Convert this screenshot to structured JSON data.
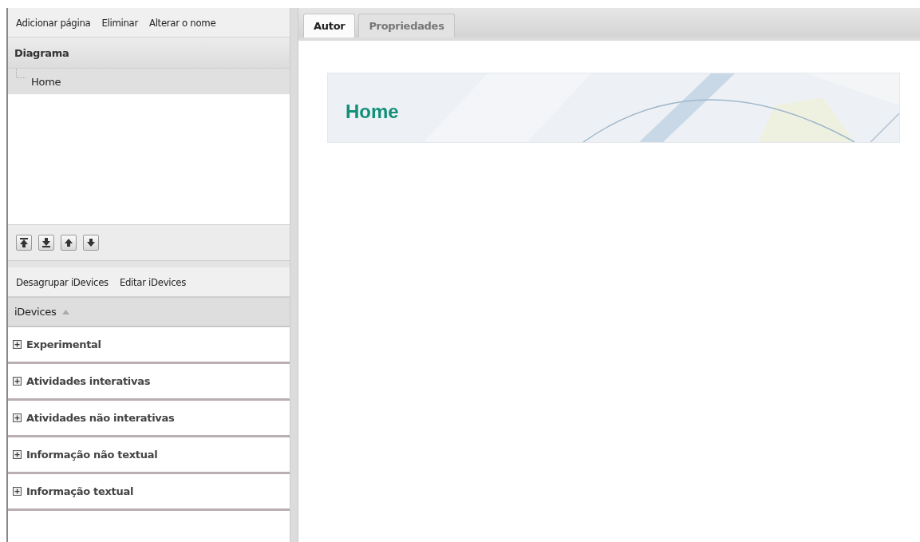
{
  "outline_panel": {
    "toolbar": [
      "Adicionar página",
      "Eliminar",
      "Alterar o nome"
    ],
    "header": "Diagrama",
    "tree": [
      {
        "label": "Home",
        "selected": true
      }
    ],
    "move_buttons": [
      {
        "kind": "top"
      },
      {
        "kind": "bottom"
      },
      {
        "kind": "up"
      },
      {
        "kind": "down"
      }
    ]
  },
  "idevices_panel": {
    "toolbar": [
      "Desagrupar iDevices",
      "Editar iDevices"
    ],
    "header": {
      "label": "iDevices",
      "sorted_ascending": true
    },
    "groups": [
      {
        "label": "Experimental",
        "expanded": false
      },
      {
        "label": "Atividades interativas",
        "expanded": false
      },
      {
        "label": "Atividades não interativas",
        "expanded": false
      },
      {
        "label": "Informação não textual",
        "expanded": false
      },
      {
        "label": "Informação textual",
        "expanded": false
      }
    ]
  },
  "tabs": [
    {
      "label": "Autor",
      "selected": true
    },
    {
      "label": "Propriedades",
      "selected": false
    }
  ],
  "page": {
    "title": "Home"
  }
}
